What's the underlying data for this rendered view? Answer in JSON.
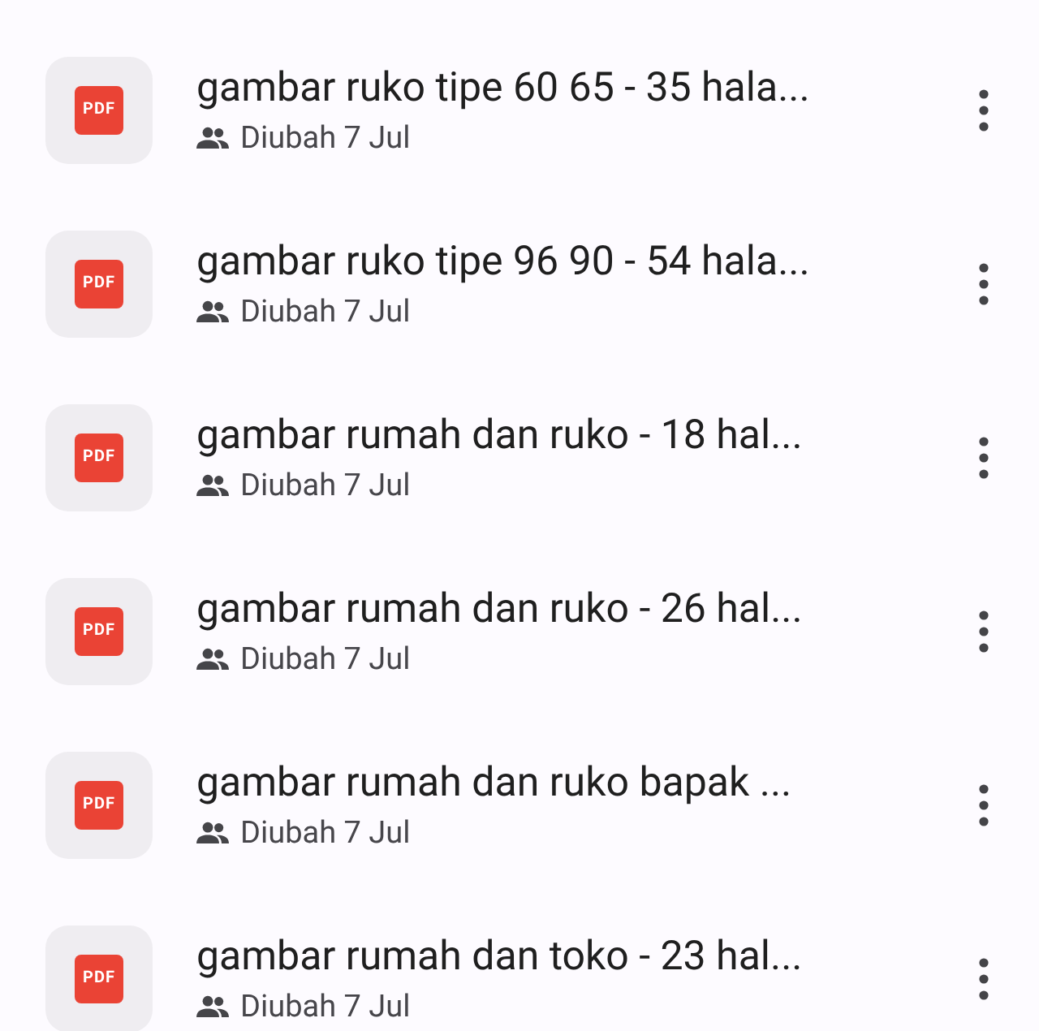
{
  "files": [
    {
      "badge": "PDF",
      "title": "gambar ruko tipe 60 65 - 35 hala...",
      "meta": "Diubah 7 Jul",
      "shared": true
    },
    {
      "badge": "PDF",
      "title": "gambar ruko tipe 96 90 - 54 hala...",
      "meta": "Diubah 7 Jul",
      "shared": true
    },
    {
      "badge": "PDF",
      "title": "gambar rumah dan ruko - 18 hal...",
      "meta": "Diubah 7 Jul",
      "shared": true
    },
    {
      "badge": "PDF",
      "title": "gambar rumah dan ruko - 26 hal...",
      "meta": "Diubah 7 Jul",
      "shared": true
    },
    {
      "badge": "PDF",
      "title": "gambar rumah dan ruko bapak ...",
      "meta": "Diubah 7 Jul",
      "shared": true
    },
    {
      "badge": "PDF",
      "title": "gambar rumah dan toko - 23 hal...",
      "meta": "Diubah 7 Jul",
      "shared": true
    }
  ]
}
